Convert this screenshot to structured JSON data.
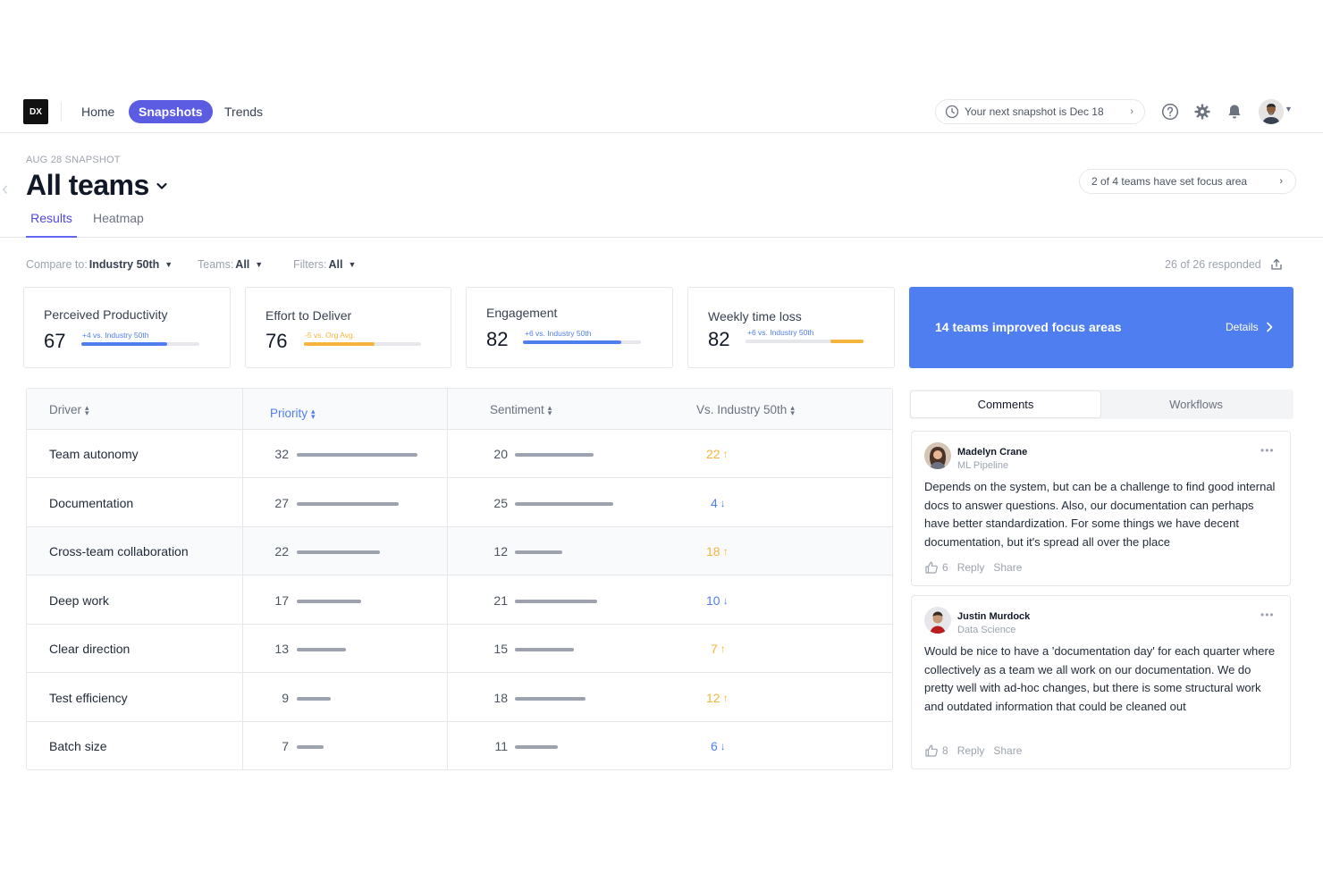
{
  "nav": {
    "logo": "DX",
    "links": [
      {
        "label": "Home",
        "active": false
      },
      {
        "label": "Snapshots",
        "active": true
      },
      {
        "label": "Trends",
        "active": false
      }
    ],
    "next_snapshot": "Your next snapshot is Dec 18"
  },
  "header": {
    "snapshot_label": "AUG 28 SNAPSHOT",
    "title": "All teams",
    "focus_pill": "2 of 4 teams have set focus area",
    "tabs": [
      {
        "label": "Results",
        "active": true
      },
      {
        "label": "Heatmap",
        "active": false
      }
    ]
  },
  "filters": {
    "compare_label": "Compare to:",
    "compare_value": "Industry 50th",
    "teams_label": "Teams:",
    "teams_value": "All",
    "filters_label": "Filters:",
    "filters_value": "All",
    "responded": "26 of 26 responded"
  },
  "metrics": [
    {
      "title": "Perceived Productivity",
      "value": "67",
      "sub": "+4 vs. Industry 50th",
      "tone": "blue",
      "progress": 0.73
    },
    {
      "title": "Effort to Deliver",
      "value": "76",
      "sub": "-5 vs. Org Avg.",
      "tone": "yellow",
      "progress": 0.6
    },
    {
      "title": "Engagement",
      "value": "82",
      "sub": "+6 vs. Industry 50th",
      "tone": "blue",
      "progress": 0.83
    },
    {
      "title": "Weekly time loss",
      "value": "82",
      "sub": "+6 vs. Industry 50th",
      "tone": "yellow",
      "progress": 0.28
    }
  ],
  "banner": {
    "text": "14 teams improved focus areas",
    "details": "Details"
  },
  "table": {
    "headers": {
      "driver": "Driver",
      "priority": "Priority",
      "sentiment": "Sentiment",
      "vs": "Vs. Industry 50th"
    },
    "rows": [
      {
        "driver": "Team autonomy",
        "priority": 32,
        "sentiment": 20,
        "vs": "22",
        "dir": "up",
        "highlight": false
      },
      {
        "driver": "Documentation",
        "priority": 27,
        "sentiment": 25,
        "vs": "4",
        "dir": "down",
        "highlight": false
      },
      {
        "driver": "Cross-team collaboration",
        "priority": 22,
        "sentiment": 12,
        "vs": "18",
        "dir": "up",
        "highlight": true
      },
      {
        "driver": "Deep work",
        "priority": 17,
        "sentiment": 21,
        "vs": "10",
        "dir": "down",
        "highlight": false
      },
      {
        "driver": "Clear direction",
        "priority": 13,
        "sentiment": 15,
        "vs": "7",
        "dir": "up",
        "highlight": false
      },
      {
        "driver": "Test efficiency",
        "priority": 9,
        "sentiment": 18,
        "vs": "12",
        "dir": "up",
        "highlight": false
      },
      {
        "driver": "Batch size",
        "priority": 7,
        "sentiment": 11,
        "vs": "6",
        "dir": "down",
        "highlight": false
      }
    ]
  },
  "panel": {
    "tabs": [
      {
        "label": "Comments",
        "active": true
      },
      {
        "label": "Workflows",
        "active": false
      }
    ],
    "comments": [
      {
        "name": "Madelyn Crane",
        "team": "ML Pipeline",
        "text": "Depends on the system, but can be a challenge to find good internal docs to answer questions. Also, our documentation can perhaps have better standardization. For some things we have decent documentation, but it's spread all over the place",
        "likes": "6",
        "reply": "Reply",
        "share": "Share"
      },
      {
        "name": "Justin Murdock",
        "team": "Data Science",
        "text": "Would be nice to have a 'documentation day' for each quarter where collectively as a team we all work on our documentation. We do pretty well with ad-hoc changes, but there is some structural work and outdated information that could be cleaned out",
        "likes": "8",
        "reply": "Reply",
        "share": "Share"
      }
    ]
  },
  "colors": {
    "accent": "#5b5ce2",
    "blue": "#4f7ef0",
    "yellow": "#f5b43c",
    "banner": "#4f7ef0"
  }
}
